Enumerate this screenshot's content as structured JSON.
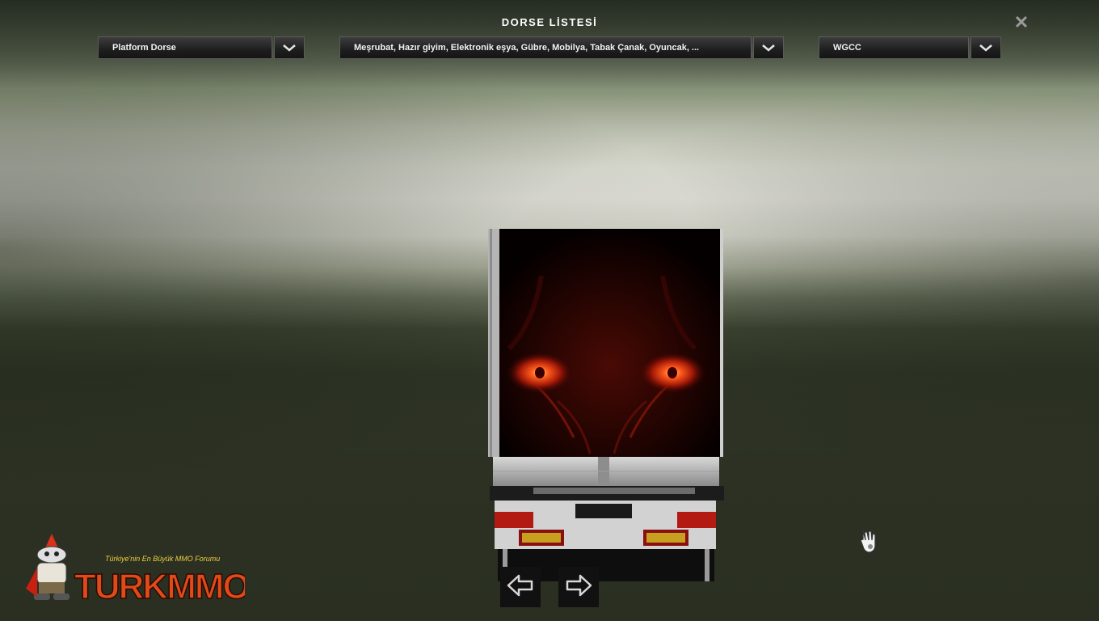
{
  "window": {
    "title": "DORSE LİSTESİ"
  },
  "filters": {
    "trailer_type": {
      "value": "Platform Dorse"
    },
    "cargo": {
      "value": "Meşrubat, Hazır giyim, Elektronik eşya, Gübre, Mobilya, Tabak Çanak, Oyuncak, ..."
    },
    "company": {
      "value": "WGCC"
    }
  },
  "icons": {
    "close": "close-icon",
    "dropdown": "chevron-down-icon",
    "previous": "arrow-left-icon",
    "next": "arrow-right-icon",
    "cursor": "hand-cursor-icon"
  },
  "branding": {
    "logo_tagline": "Türkiye'nin En Büyük MMO Forumu",
    "logo_text": "TURKMMO"
  },
  "colors": {
    "accent": "#e8561a",
    "panel": "#1e1e1e",
    "text": "#ffffff"
  }
}
